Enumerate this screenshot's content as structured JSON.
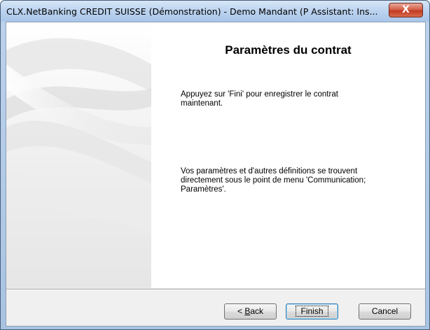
{
  "window": {
    "title": "CLX.NetBanking CREDIT SUISSE (Démonstration) - Demo Mandant (P Assistant: Ins...",
    "close_glyph": "X"
  },
  "content": {
    "heading": "Paramètres du contrat",
    "paragraph1": "Appuyez sur 'Fini' pour enregistrer le contrat\nmaintenant.",
    "paragraph2": "Vos paramètres et d'autres définitions se trouvent\ndirectement sous le point de menu 'Communication;\nParamètres'."
  },
  "buttons": {
    "back_prefix": "< ",
    "back_mnemonic": "B",
    "back_rest": "ack",
    "finish": "Finish",
    "cancel": "Cancel"
  }
}
